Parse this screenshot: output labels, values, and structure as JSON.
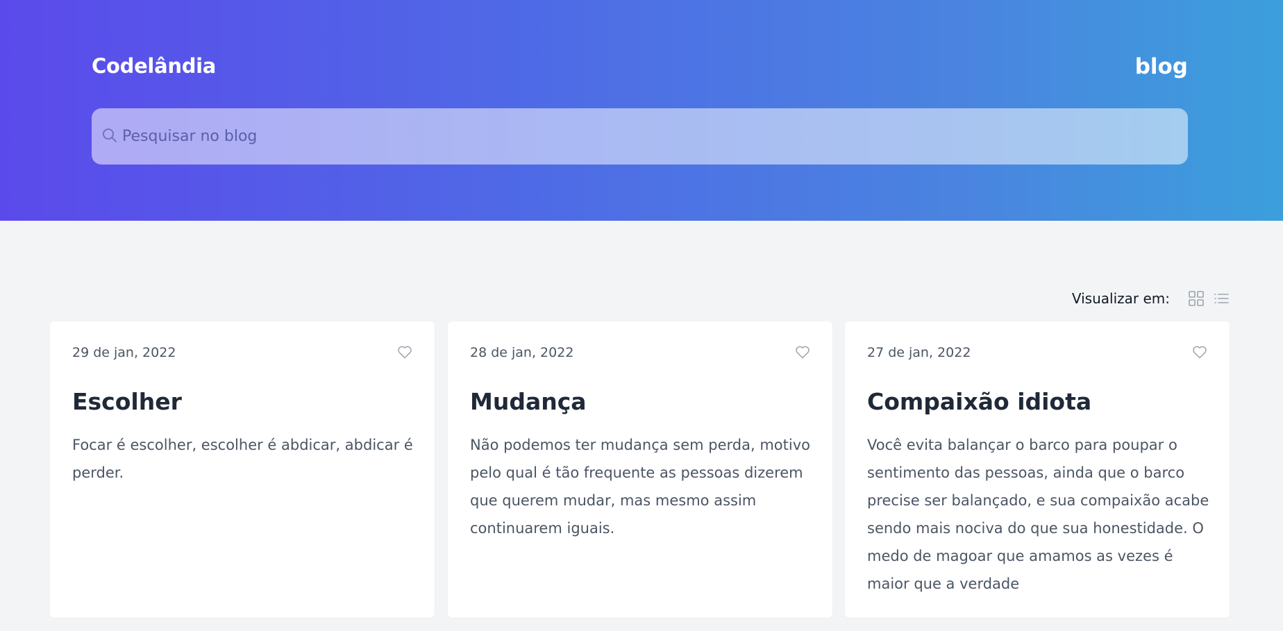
{
  "header": {
    "brand": "Codelândia",
    "nav_link": "blog"
  },
  "search": {
    "placeholder": "Pesquisar no blog",
    "value": ""
  },
  "view_toggle": {
    "label": "Visualizar em:",
    "options": [
      "grid-icon",
      "list-icon"
    ]
  },
  "posts": [
    {
      "date": "29 de jan, 2022",
      "title": "Escolher",
      "excerpt": "Focar é escolher, escolher é abdicar, abdicar é perder."
    },
    {
      "date": "28 de jan, 2022",
      "title": "Mudança",
      "excerpt": "Não podemos ter mudança sem perda, motivo pelo qual é tão frequente as pessoas dizerem que querem mudar, mas mesmo assim continuarem iguais."
    },
    {
      "date": "27 de jan, 2022",
      "title": "Compaixão idiota",
      "excerpt": "Você evita balançar o barco para poupar o sentimento das pessoas, ainda que o barco precise ser balançado, e sua compaixão acabe sendo mais nociva do que sua honestidade. O medo de magoar que amamos as vezes é maior que a verdade"
    }
  ],
  "colors": {
    "gradient_start": "#5b4aeb",
    "gradient_end": "#3c9fdc",
    "background": "#f3f4f6",
    "card": "#ffffff"
  }
}
